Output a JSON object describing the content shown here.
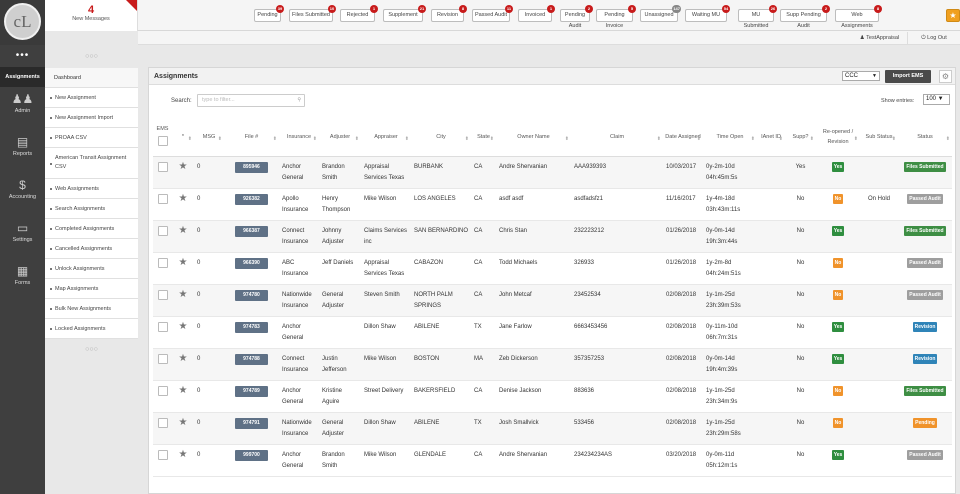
{
  "header": {
    "logo": "cL",
    "messages_count": "4",
    "messages_label": "New Messages",
    "filters": [
      {
        "label": "Pending",
        "count": "39"
      },
      {
        "label": "Files Submitted",
        "count": "10"
      },
      {
        "label": "Rejected",
        "count": "1"
      },
      {
        "label": "Supplement",
        "count": "21"
      },
      {
        "label": "Revision",
        "count": "8"
      },
      {
        "label": "Passed Audit",
        "count": "11"
      },
      {
        "label": "Invoiced",
        "count": "1"
      },
      {
        "label": "Pending Audit",
        "count": "2"
      },
      {
        "label": "Pending Invoice",
        "count": "5"
      },
      {
        "label": "Unassigned",
        "count": "147"
      },
      {
        "label": "Waiting MU",
        "count": "54"
      },
      {
        "label": "MU Submitted",
        "count": "26"
      },
      {
        "label": "Supp Pending Audit",
        "count": "2"
      },
      {
        "label": "Web Assignments",
        "count": "8"
      }
    ],
    "user": "TestAppraisal",
    "logout": "Log Out"
  },
  "leftnav": {
    "dots": "•••",
    "items": [
      "Assignments",
      "Admin",
      "Reports",
      "Accounting",
      "Settings",
      "Forms"
    ]
  },
  "subnav": {
    "top_dots": "○○○",
    "items": [
      "Dashboard",
      "New Assignment",
      "New Assignment Import",
      "PROAA CSV",
      "American Transit Assignment CSV",
      "Web Assignments",
      "Search Assignments",
      "Completed Assignments",
      "Cancelled Assignments",
      "Unlock Assignments",
      "Map Assignments",
      "Bulk New Assignments",
      "Locked Assignments"
    ],
    "bottom_dots": "○○○"
  },
  "panel": {
    "title": "Assignments",
    "dropdown": "CCC",
    "import_button": "Import EMS",
    "search_label": "Search:",
    "search_placeholder": "type to filter...",
    "show_label": "Show entries:",
    "show_value": "100"
  },
  "table": {
    "columns": [
      "EMS",
      "*",
      "MSG",
      "File #",
      "Insurance",
      "Adjuster",
      "Appraiser",
      "City",
      "State",
      "Owner Name",
      "Claim",
      "Date Assigned",
      "Time Open",
      "IAnet ID",
      "Supp?",
      "Re-opened / Revision",
      "Sub Status",
      "Status"
    ],
    "rows": [
      {
        "msg": "0",
        "file": "895946",
        "insurance": "Anchor General",
        "adjuster": "Brandon Smith",
        "appraiser": "Appraisal Services Texas",
        "city": "BURBANK",
        "state": "CA",
        "owner": "Andre Shervanian",
        "claim": "AAA939393",
        "date": "10/03/2017",
        "time": "0y-2m-10d 04h:45m:5s",
        "ianet": "",
        "supp": "Yes",
        "reopened": "Yes",
        "substatus": "",
        "status": "Files Submitted"
      },
      {
        "msg": "0",
        "file": "926382",
        "insurance": "Apollo Insurance",
        "adjuster": "Henry Thompson",
        "appraiser": "Mike Wilson",
        "city": "LOS ANGELES",
        "state": "CA",
        "owner": "asdf asdf",
        "claim": "asdfadsfz1",
        "date": "11/16/2017",
        "time": "1y-4m-18d 03h:43m:11s",
        "ianet": "",
        "supp": "No",
        "reopened": "No",
        "substatus": "On Hold",
        "status": "Passed Audit"
      },
      {
        "msg": "0",
        "file": "966387",
        "insurance": "Connect Insurance",
        "adjuster": "Johnny Adjuster",
        "appraiser": "Claims Services inc",
        "city": "SAN BERNARDINO",
        "state": "CA",
        "owner": "Chris Stan",
        "claim": "232223212",
        "date": "01/26/2018",
        "time": "0y-0m-14d 19h:3m:44s",
        "ianet": "",
        "supp": "No",
        "reopened": "Yes",
        "substatus": "",
        "status": "Files Submitted"
      },
      {
        "msg": "0",
        "file": "966390",
        "insurance": "ABC Insurance",
        "adjuster": "Jeff Daniels",
        "appraiser": "Appraisal Services Texas",
        "city": "CABAZON",
        "state": "CA",
        "owner": "Todd Michaels",
        "claim": "326933",
        "date": "01/26/2018",
        "time": "1y-2m-8d 04h:24m:51s",
        "ianet": "",
        "supp": "No",
        "reopened": "No",
        "substatus": "",
        "status": "Passed Audit"
      },
      {
        "msg": "0",
        "file": "974780",
        "insurance": "Nationwide Insurance",
        "adjuster": "General Adjuster",
        "appraiser": "Steven Smith",
        "city": "NORTH PALM SPRINGS",
        "state": "CA",
        "owner": "John Metcaf",
        "claim": "23452534",
        "date": "02/08/2018",
        "time": "1y-1m-25d 23h:39m:53s",
        "ianet": "",
        "supp": "No",
        "reopened": "No",
        "substatus": "",
        "status": "Passed Audit"
      },
      {
        "msg": "0",
        "file": "974783",
        "insurance": "Anchor General",
        "adjuster": "",
        "appraiser": "Dillon Shaw",
        "city": "ABILENE",
        "state": "TX",
        "owner": "Jane Farlow",
        "claim": "6663453456",
        "date": "02/08/2018",
        "time": "0y-11m-10d 06h:7m:31s",
        "ianet": "",
        "supp": "No",
        "reopened": "Yes",
        "substatus": "",
        "status": "Revision"
      },
      {
        "msg": "0",
        "file": "974788",
        "insurance": "Connect Insurance",
        "adjuster": "Justin Jefferson",
        "appraiser": "Mike Wilson",
        "city": "BOSTON",
        "state": "MA",
        "owner": "Zeb Dickerson",
        "claim": "357357253",
        "date": "02/08/2018",
        "time": "0y-0m-14d 19h:4m:39s",
        "ianet": "",
        "supp": "No",
        "reopened": "Yes",
        "substatus": "",
        "status": "Revision"
      },
      {
        "msg": "0",
        "file": "974789",
        "insurance": "Anchor General",
        "adjuster": "Kristine Aguire",
        "appraiser": "Street Delivery",
        "city": "BAKERSFIELD",
        "state": "CA",
        "owner": "Denise Jackson",
        "claim": "883636",
        "date": "02/08/2018",
        "time": "1y-1m-25d 23h:34m:9s",
        "ianet": "",
        "supp": "No",
        "reopened": "No",
        "substatus": "",
        "status": "Files Submitted"
      },
      {
        "msg": "0",
        "file": "974791",
        "insurance": "Nationwide Insurance",
        "adjuster": "General Adjuster",
        "appraiser": "Dillon Shaw",
        "city": "ABILENE",
        "state": "TX",
        "owner": "Josh Smallvick",
        "claim": "533456",
        "date": "02/08/2018",
        "time": "1y-1m-25d 23h:29m:58s",
        "ianet": "",
        "supp": "No",
        "reopened": "No",
        "substatus": "",
        "status": "Pending"
      },
      {
        "msg": "0",
        "file": "999700",
        "insurance": "Anchor General",
        "adjuster": "Brandon Smith",
        "appraiser": "Mike Wilson",
        "city": "GLENDALE",
        "state": "CA",
        "owner": "Andre Shervanian",
        "claim": "234234234AS",
        "date": "03/20/2018",
        "time": "0y-0m-11d 05h:12m:1s",
        "ianet": "",
        "supp": "No",
        "reopened": "Yes",
        "substatus": "",
        "status": "Passed Audit"
      }
    ]
  },
  "colors": {
    "accent_red": "#c81b1b",
    "yes_green": "#2f8e3f",
    "no_orange": "#f0932b",
    "revision_blue": "#2f84b8",
    "passed_grey": "#9e9e9e",
    "file_badge": "#5f7186",
    "nav_dark": "#3f3f3f"
  }
}
